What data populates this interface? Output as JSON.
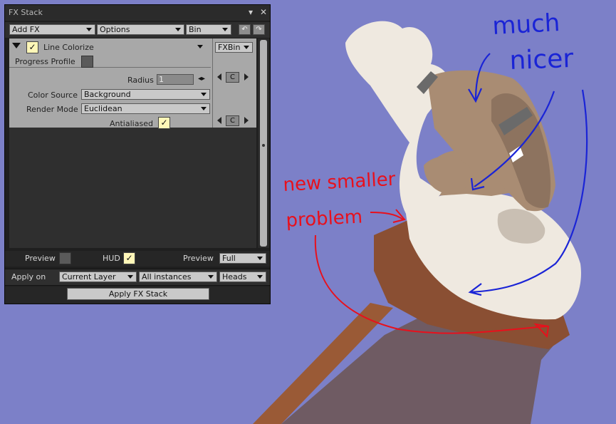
{
  "panel": {
    "title": "FX Stack",
    "toolbar": {
      "add_fx": "Add FX",
      "options": "Options",
      "bin": "Bin"
    },
    "fx": {
      "name": "Line Colorize",
      "enabled": true,
      "bin_button": "FXBin",
      "progress_profile_label": "Progress Profile",
      "radius_label": "Radius",
      "radius_value": "1",
      "color_source_label": "Color Source",
      "color_source_value": "Background",
      "render_mode_label": "Render Mode",
      "render_mode_value": "Euclidean",
      "antialiased_label": "Antialiased",
      "antialiased": true,
      "c_button": "C"
    },
    "preview_label": "Preview",
    "hud_label": "HUD",
    "preview2_label": "Preview",
    "preview2_value": "Full",
    "apply_on_label": "Apply on",
    "apply_layer": "Current Layer",
    "apply_instances": "All instances",
    "apply_heads": "Heads",
    "apply_button": "Apply FX Stack"
  },
  "annotations": {
    "much": "much",
    "nicer": "nicer",
    "new_smaller": "new smaller",
    "problem": "problem"
  },
  "colors": {
    "background": "#7c80c8",
    "annotation_blue": "#1a24d6",
    "annotation_red": "#e8101c",
    "cream": "#efe9e0",
    "brown": "#8a4f33"
  },
  "icons": {
    "undo": "undo-icon",
    "redo": "redo-icon",
    "collapse": "triangle-down-icon",
    "close": "close-icon",
    "menu": "chevron-down-icon"
  }
}
